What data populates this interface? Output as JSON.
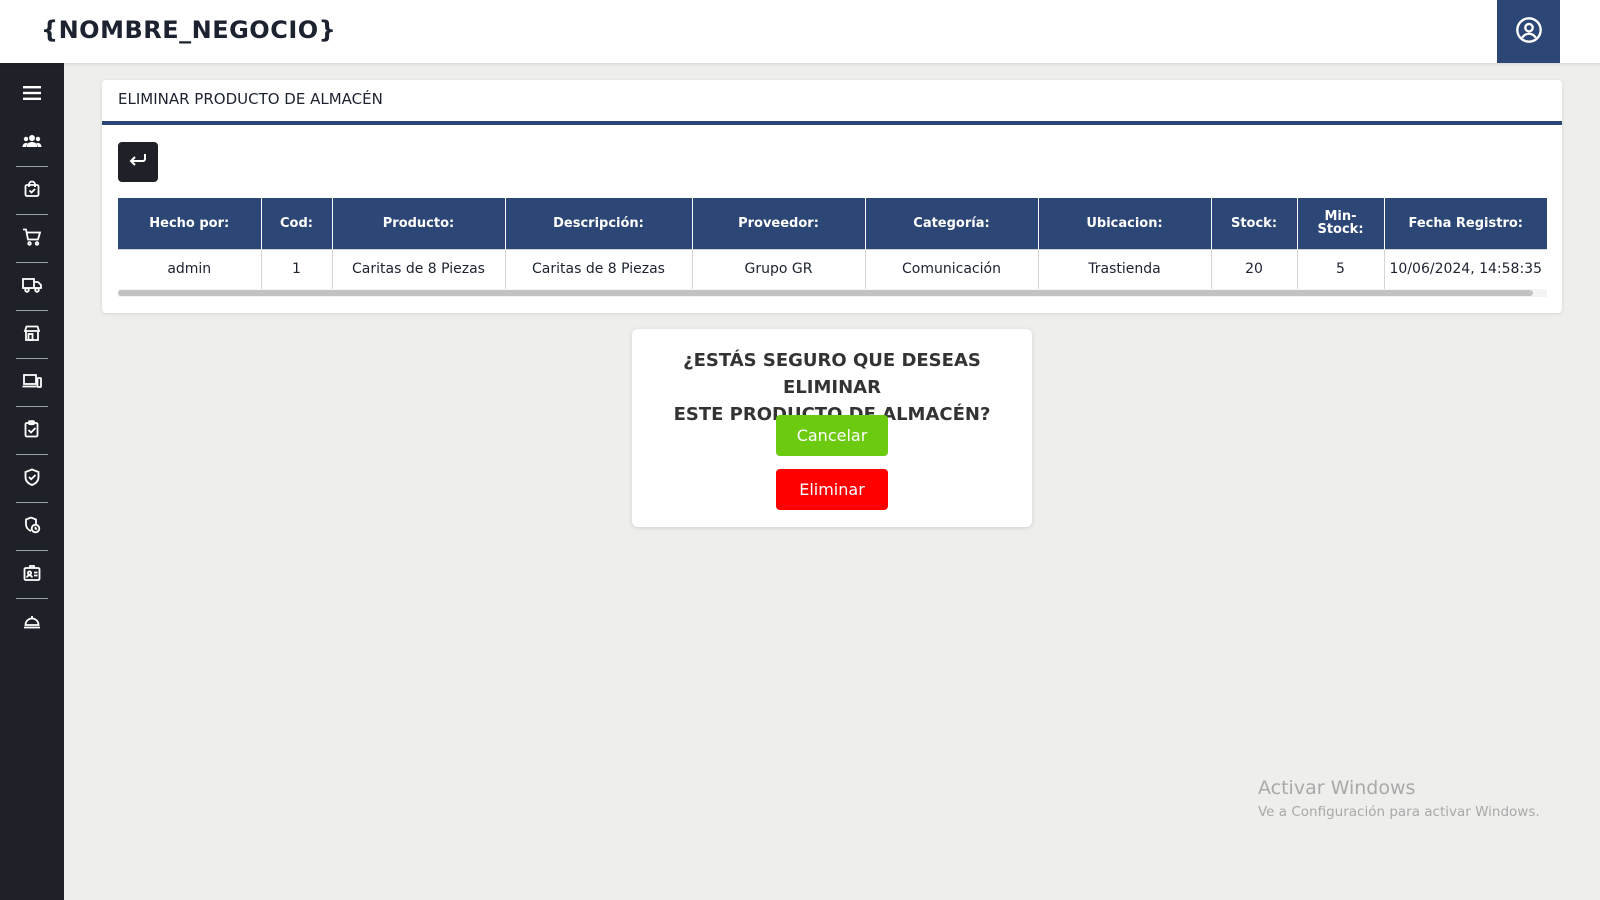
{
  "header": {
    "brand": "{NOMBRE_NEGOCIO}"
  },
  "sidebar": {
    "items": [
      {
        "icon": "menu-icon"
      },
      {
        "icon": "users-icon"
      },
      {
        "icon": "shopping-bag-icon"
      },
      {
        "icon": "cart-icon"
      },
      {
        "icon": "truck-icon"
      },
      {
        "icon": "store-icon"
      },
      {
        "icon": "devices-icon"
      },
      {
        "icon": "clipboard-check-icon"
      },
      {
        "icon": "shield-check-icon"
      },
      {
        "icon": "badge-clock-icon"
      },
      {
        "icon": "id-card-icon"
      },
      {
        "icon": "service-bell-icon"
      }
    ]
  },
  "page": {
    "title": "ELIMINAR PRODUCTO DE ALMACÉN",
    "table": {
      "headers": [
        "Hecho por:",
        "Cod:",
        "Producto:",
        "Descripción:",
        "Proveedor:",
        "Categoría:",
        "Ubicacion:",
        "Stock:",
        "Min-Stock:",
        "Fecha Registro:"
      ],
      "rows": [
        [
          "admin",
          "1",
          "Caritas de 8 Piezas",
          "Caritas de 8 Piezas",
          "Grupo GR",
          "Comunicación",
          "Trastienda",
          "20",
          "5",
          "10/06/2024, 14:58:35"
        ]
      ]
    }
  },
  "dialog": {
    "message_line1": "¿ESTÁS SEGURO QUE DESEAS ELIMINAR",
    "message_line2": "ESTE PRODUCTO DE ALMACÉN?",
    "cancel_label": "Cancelar",
    "delete_label": "Eliminar"
  },
  "watermark": {
    "title": "Activar Windows",
    "subtitle": "Ve a Configuración para activar Windows."
  },
  "colors": {
    "primary": "#2c4675",
    "sidebar": "#1e2228",
    "cancel": "#6ccb10",
    "delete": "#ff0000",
    "background": "#eeeeec"
  }
}
